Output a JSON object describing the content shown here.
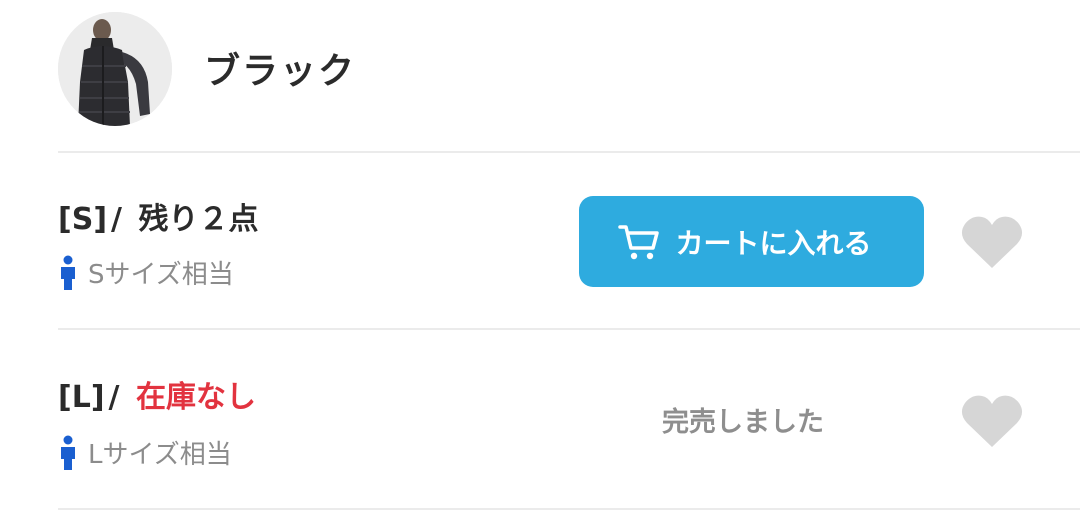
{
  "variant": {
    "color_name": "ブラック",
    "thumbnail_icon": "product-thumbnail-black-down-vest"
  },
  "rows": [
    {
      "size": "[S]",
      "separator": "/",
      "stock": "残り２点",
      "stock_color": "#2b2b2b",
      "fit_hint": "Sサイズ相当",
      "person_icon": "person-icon",
      "action": {
        "type": "button",
        "label": "カートに入れる",
        "icon": "cart-icon",
        "color": "#2eabdf"
      },
      "favorite_icon": "heart-icon"
    },
    {
      "size": "[L]",
      "separator": "/",
      "stock": "在庫なし",
      "stock_color": "#e2333f",
      "fit_hint": "Lサイズ相当",
      "person_icon": "person-icon",
      "action": {
        "type": "text",
        "label": "完売しました"
      },
      "favorite_icon": "heart-icon"
    }
  ],
  "colors": {
    "accent": "#2eabdf",
    "person_icon": "#1a5fd0",
    "heart": "#d6d6d6",
    "divider": "#ebebeb"
  }
}
